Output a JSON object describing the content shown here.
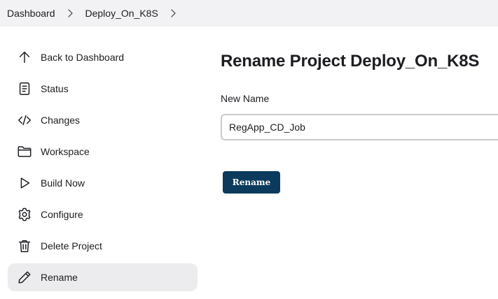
{
  "breadcrumb": {
    "items": [
      {
        "label": "Dashboard"
      },
      {
        "label": "Deploy_On_K8S"
      }
    ],
    "separator_icon": "chevron-right-icon"
  },
  "sidebar": {
    "items": [
      {
        "label": "Back to Dashboard",
        "icon": "arrow-up-icon"
      },
      {
        "label": "Status",
        "icon": "document-icon"
      },
      {
        "label": "Changes",
        "icon": "code-icon"
      },
      {
        "label": "Workspace",
        "icon": "folder-icon"
      },
      {
        "label": "Build Now",
        "icon": "play-icon"
      },
      {
        "label": "Configure",
        "icon": "gear-icon"
      },
      {
        "label": "Delete Project",
        "icon": "trash-icon"
      },
      {
        "label": "Rename",
        "icon": "pencil-icon",
        "active": true
      }
    ]
  },
  "main": {
    "title": "Rename Project Deploy_On_K8S",
    "new_name_label": "New Name",
    "new_name_value": "RegApp_CD_Job",
    "rename_button": "Rename"
  },
  "colors": {
    "breadcrumb_bg": "#f2f2f5",
    "active_item_bg": "#ececef",
    "button_bg": "#0b3a5c",
    "button_text": "#ffffff",
    "text": "#1d1d22"
  }
}
